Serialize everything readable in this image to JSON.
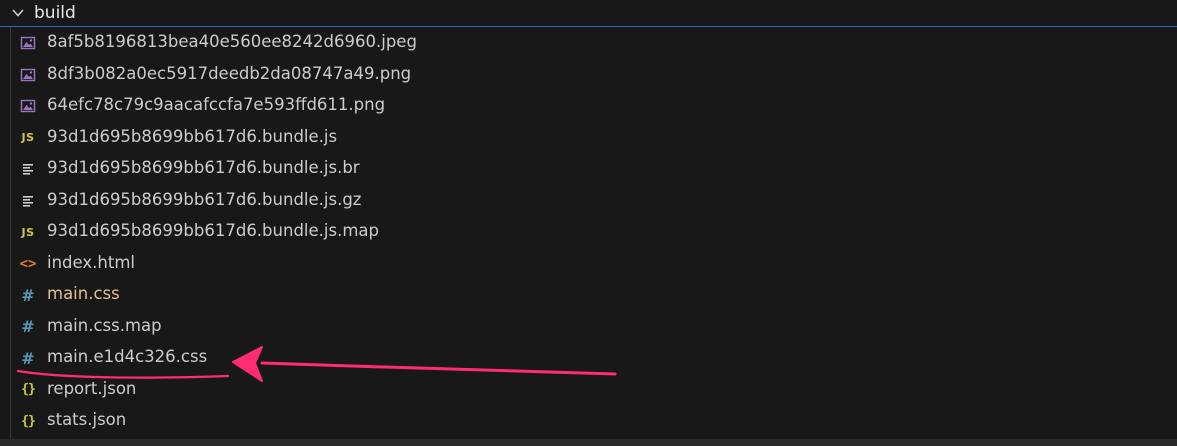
{
  "folder": {
    "name": "build",
    "expanded": true
  },
  "files": [
    {
      "name": "8af5b8196813bea40e560ee8242d6960.jpeg",
      "icon": "image-icon"
    },
    {
      "name": "8df3b082a0ec5917deedb2da08747a49.png",
      "icon": "image-icon"
    },
    {
      "name": "64efc78c79c9aacafccfa7e593ffd611.png",
      "icon": "image-icon"
    },
    {
      "name": "93d1d695b8699bb617d6.bundle.js",
      "icon": "js-icon",
      "icon_text": "JS"
    },
    {
      "name": "93d1d695b8699bb617d6.bundle.js.br",
      "icon": "text-file-icon"
    },
    {
      "name": "93d1d695b8699bb617d6.bundle.js.gz",
      "icon": "text-file-icon"
    },
    {
      "name": "93d1d695b8699bb617d6.bundle.js.map",
      "icon": "js-icon",
      "icon_text": "JS"
    },
    {
      "name": "index.html",
      "icon": "html-icon",
      "icon_text": "<>"
    },
    {
      "name": "main.css",
      "icon": "css-icon",
      "icon_text": "#",
      "modified": true
    },
    {
      "name": "main.css.map",
      "icon": "css-icon",
      "icon_text": "#"
    },
    {
      "name": "main.e1d4c326.css",
      "icon": "css-icon",
      "icon_text": "#",
      "annotated": true
    },
    {
      "name": "report.json",
      "icon": "json-icon",
      "icon_text": "{}"
    },
    {
      "name": "stats.json",
      "icon": "json-icon",
      "icon_text": "{}"
    }
  ],
  "colors": {
    "background": "#181818",
    "text": "#cccccc",
    "modified_text": "#e2c08d",
    "js": "#cbcb41",
    "css": "#519aba",
    "html": "#e37933",
    "json": "#cbcb41",
    "image": "#a074c4",
    "annotation": "#ff2d6f",
    "focus_border": "#2b6fc0"
  }
}
